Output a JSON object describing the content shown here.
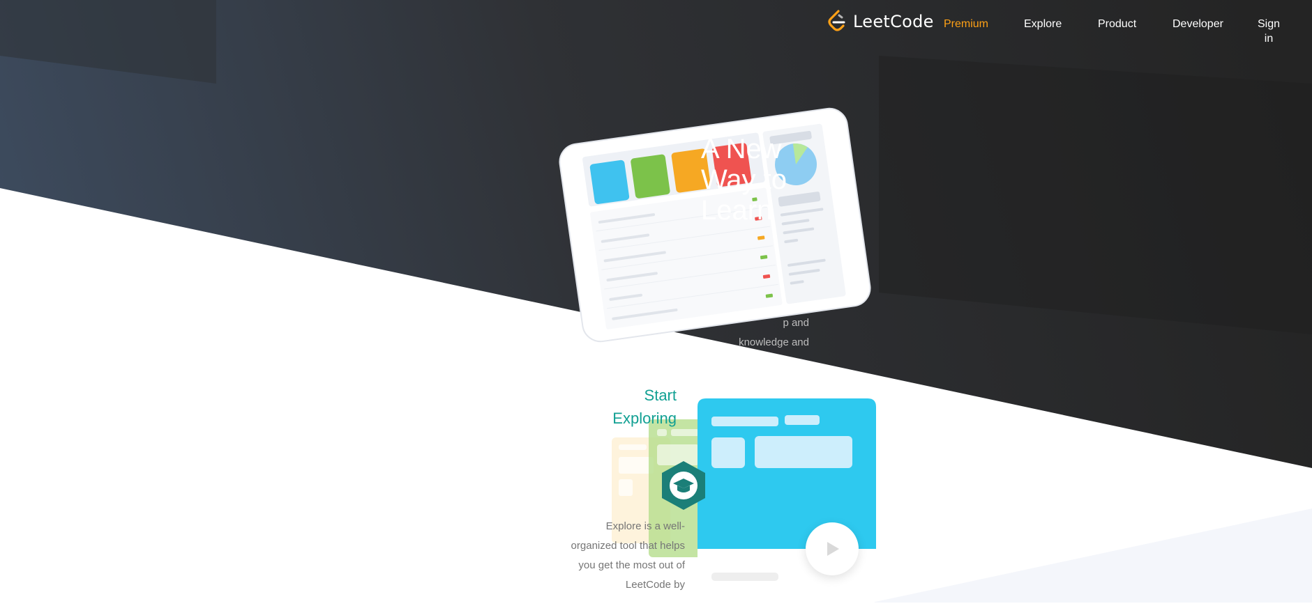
{
  "brand": {
    "name": "LeetCode",
    "colors": {
      "dark_bg": "#262626",
      "premium_orange": "#ffa116",
      "teal": "#12a093"
    }
  },
  "nav": {
    "items": [
      {
        "label": "Premium"
      },
      {
        "label": "Explore"
      },
      {
        "label": "Product"
      },
      {
        "label": "Developer"
      },
      {
        "label": "Sign in"
      }
    ]
  },
  "hero": {
    "title": "A New Way to Learn",
    "description_fragments": [
      "p and",
      "knowledge and"
    ]
  },
  "explore": {
    "heading": "Start Exploring",
    "description": "Explore is a well-organized tool that helps you get the most out of LeetCode by"
  },
  "icons": {
    "logo": "leetcode-logo-icon",
    "play": "play-icon",
    "graduation": "graduation-cap-icon"
  }
}
